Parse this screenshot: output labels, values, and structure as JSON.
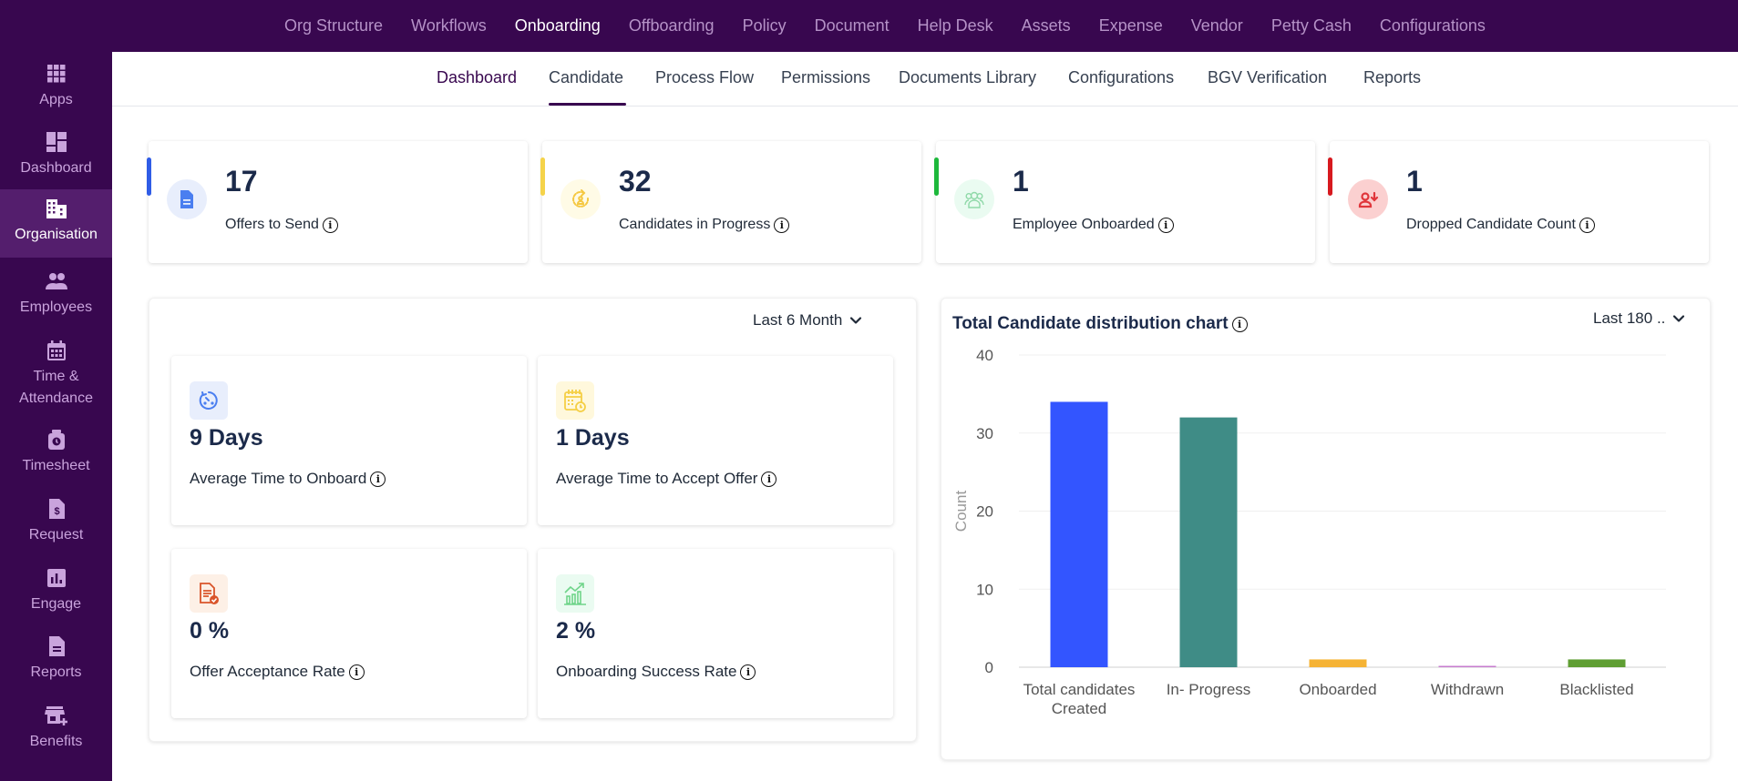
{
  "sidebar": {
    "items": [
      {
        "label": "Apps",
        "icon": "apps-grid-icon"
      },
      {
        "label": "Dashboard",
        "icon": "dashboard-icon"
      },
      {
        "label": "Organisation",
        "icon": "building-icon",
        "active": true
      },
      {
        "label": "Employees",
        "icon": "people-icon"
      },
      {
        "label": "Time & Attendance",
        "icon": "calendar-icon"
      },
      {
        "label": "Timesheet",
        "icon": "timesheet-icon"
      },
      {
        "label": "Request",
        "icon": "request-dollar-icon"
      },
      {
        "label": "Engage",
        "icon": "bar-chart-icon"
      },
      {
        "label": "Reports",
        "icon": "document-icon"
      },
      {
        "label": "Benefits",
        "icon": "store-plus-icon"
      }
    ]
  },
  "topnav": {
    "items": [
      "Org Structure",
      "Workflows",
      "Onboarding",
      "Offboarding",
      "Policy",
      "Document",
      "Help Desk",
      "Assets",
      "Expense",
      "Vendor",
      "Petty Cash",
      "Configurations"
    ],
    "active": "Onboarding"
  },
  "subnav": {
    "tabs": [
      "Dashboard",
      "Candidate",
      "Process Flow",
      "Permissions",
      "Documents Library",
      "Configurations",
      "BGV Verification",
      "Reports"
    ],
    "active": "Dashboard"
  },
  "stats": [
    {
      "value": "17",
      "label": "Offers to Send",
      "icon": "document-icon",
      "accent": "#2f5ce6",
      "bg": "#e8eefc",
      "fg": "#4a7ef0"
    },
    {
      "value": "32",
      "label": "Candidates in Progress",
      "icon": "candidate-refresh-icon",
      "accent": "#f5d34a",
      "bg": "#fffbe6",
      "fg": "#f5c842"
    },
    {
      "value": "1",
      "label": "Employee Onboarded",
      "icon": "group-icon",
      "accent": "#1db83b",
      "bg": "#eafbf1",
      "fg": "#8fd9a8"
    },
    {
      "value": "1",
      "label": "Dropped Candidate Count",
      "icon": "user-down-icon",
      "accent": "#d7191f",
      "bg": "#fbd0d0",
      "fg": "#e0363b"
    }
  ],
  "metrics_panel": {
    "period": "Last 6 Month",
    "metrics": [
      {
        "value": "9 Days",
        "label": "Average Time to Onboard",
        "icon": "timer-icon",
        "bg": "#e8eefc",
        "fg": "#4a7ef0"
      },
      {
        "value": "1 Days",
        "label": "Average Time to Accept Offer",
        "icon": "calendar-clock-icon",
        "bg": "#fff8dc",
        "fg": "#f5cf45"
      },
      {
        "value": "0 %",
        "label": "Offer Acceptance Rate",
        "icon": "document-check-icon",
        "bg": "#fdf0e6",
        "fg": "#d9542a"
      },
      {
        "value": "2 %",
        "label": "Onboarding Success Rate",
        "icon": "growth-chart-icon",
        "bg": "#eafbf1",
        "fg": "#6fd48a"
      }
    ]
  },
  "chart_panel": {
    "title": "Total Candidate distribution chart",
    "period": "Last 180 .."
  },
  "chart_data": {
    "type": "bar",
    "title": "Total Candidate distribution chart",
    "xlabel": "",
    "ylabel": "Count",
    "ylim": [
      0,
      40
    ],
    "yticks": [
      0,
      10,
      20,
      30,
      40
    ],
    "grid": true,
    "categories": [
      "Total candidates Created",
      "In- Progress",
      "Onboarded",
      "Withdrawn",
      "Blacklisted"
    ],
    "category_lines": [
      [
        "Total candidates",
        "Created"
      ],
      [
        "In- Progress"
      ],
      [
        "Onboarded"
      ],
      [
        "Withdrawn"
      ],
      [
        "Blacklisted"
      ]
    ],
    "values": [
      34,
      32,
      1,
      0,
      1
    ],
    "colors": [
      "#3355ff",
      "#3f8c86",
      "#f5b335",
      "#c77dcf",
      "#5f9e33"
    ]
  }
}
